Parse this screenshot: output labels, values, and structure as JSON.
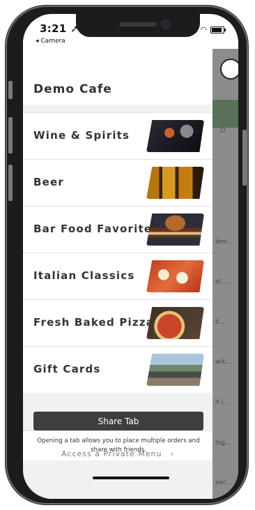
{
  "status_bar": {
    "time": "3:21",
    "back_label": "◂ Camera"
  },
  "drawer": {
    "title": "Demo Cafe",
    "categories": [
      {
        "label": "Wine & Spirits",
        "image": "wine-glasses-photo"
      },
      {
        "label": "Beer",
        "image": "beer-glasses-photo"
      },
      {
        "label": "Bar Food Favorites",
        "image": "burger-photo"
      },
      {
        "label": "Italian Classics",
        "image": "italian-dish-photo"
      },
      {
        "label": "Fresh Baked Pizza",
        "image": "pizza-photo"
      },
      {
        "label": "Gift Cards",
        "image": "cafe-patio-photo"
      }
    ],
    "private_menu_label": "Access a Private Menu",
    "share_button_label": "Share Tab",
    "share_description": "Opening a tab allows you to place multiple orders and share with friends."
  },
  "background_snippets": [
    "lem...",
    "st. ...",
    "li...",
    "ark...",
    "h l...",
    "hig...",
    "eer...."
  ],
  "colors": {
    "drawer_bg": "#f1f1f1",
    "share_button": "#3e3e3e",
    "text_primary": "#333333"
  }
}
